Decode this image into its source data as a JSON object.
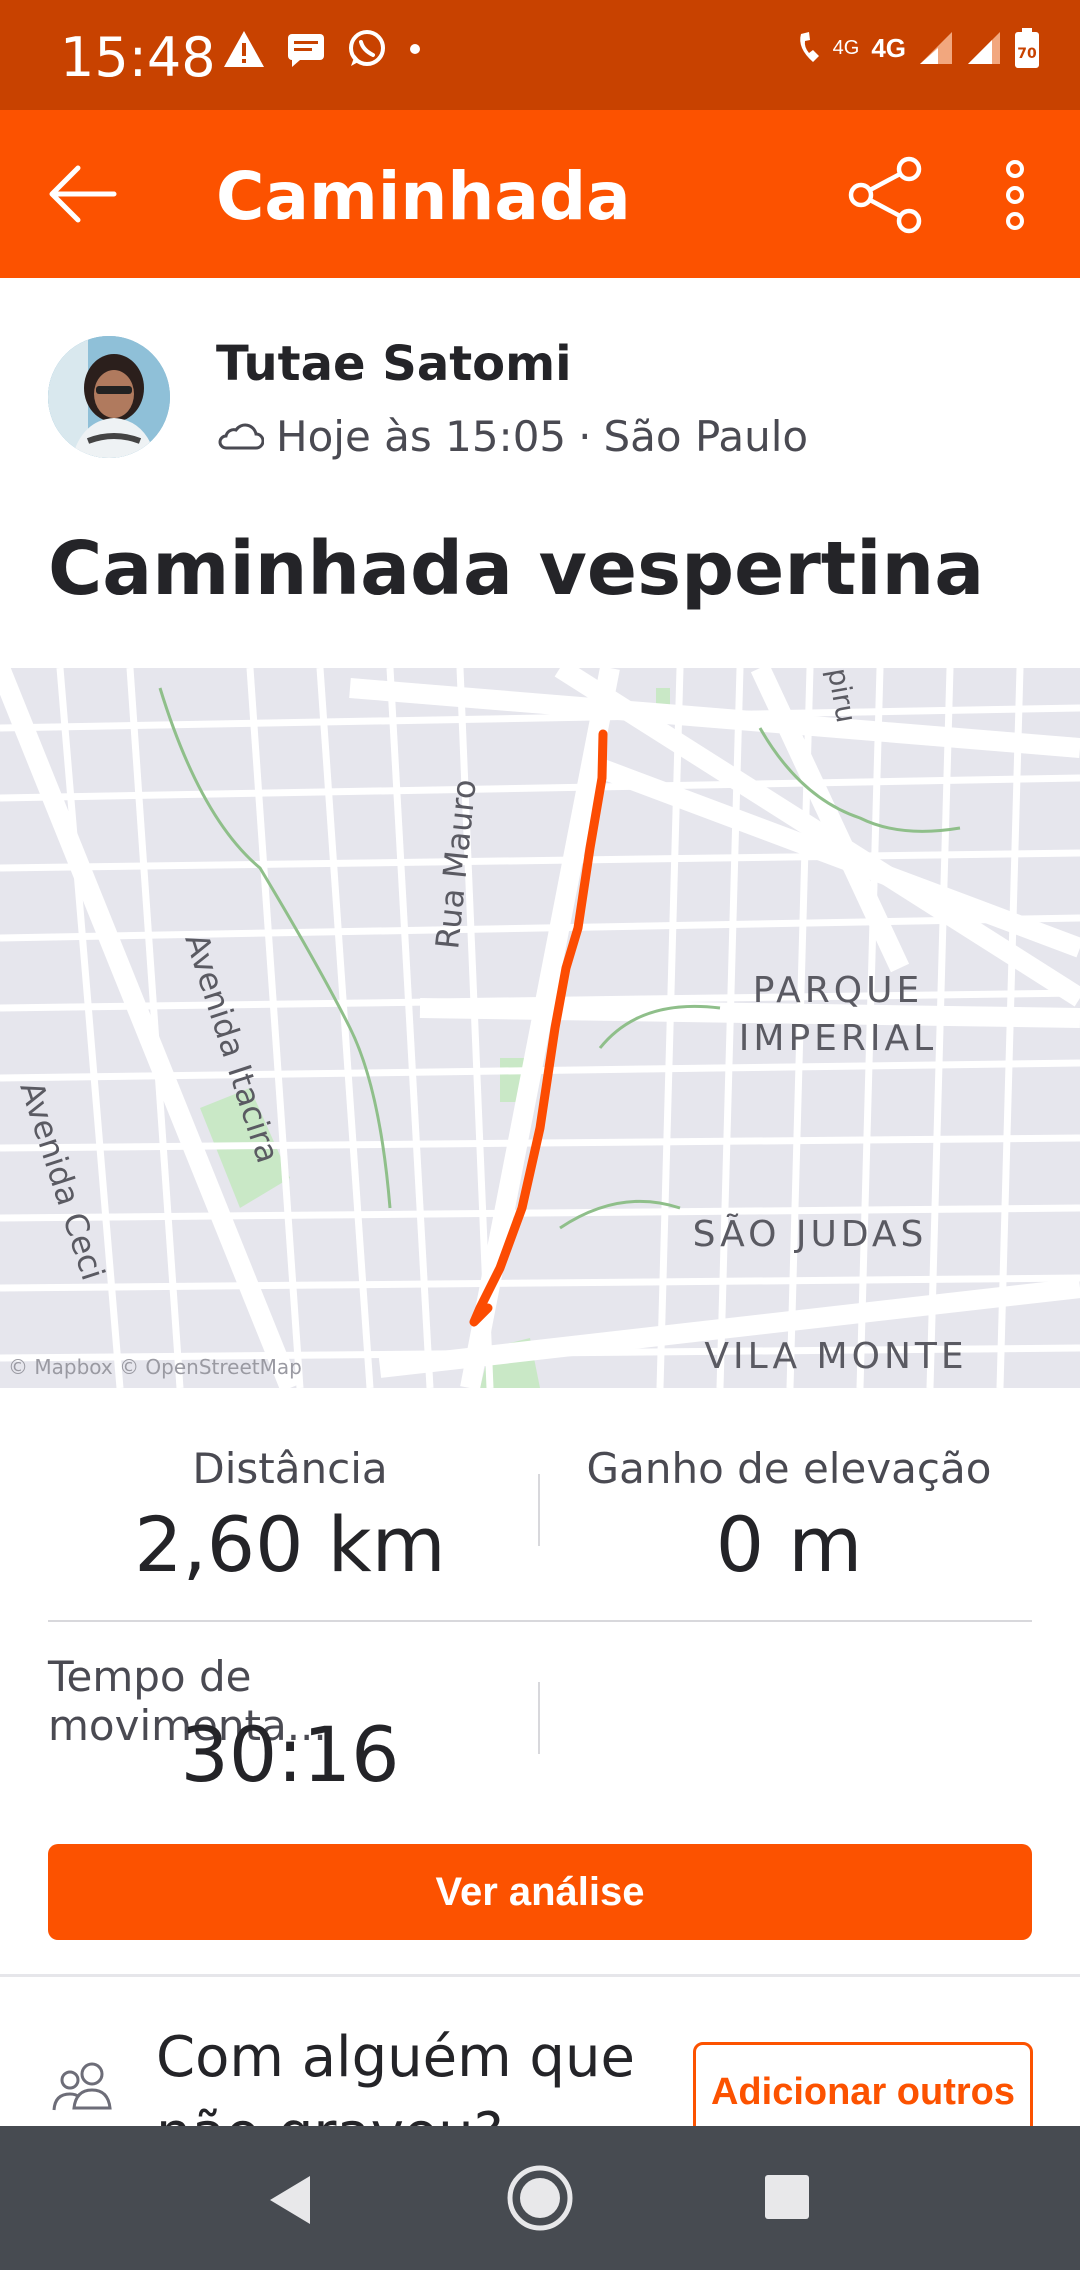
{
  "status_bar": {
    "time": "15:48",
    "network_label": "4G",
    "network_small": "4G",
    "battery": "70",
    "icons_left": [
      "warning-icon",
      "message-icon",
      "whatsapp-icon",
      "dot-icon"
    ],
    "icons_right": [
      "wifi-call-icon",
      "signal-icon",
      "signal-icon",
      "battery-icon"
    ]
  },
  "app_bar": {
    "title": "Caminhada",
    "back_icon": "arrow-left-icon",
    "share_icon": "share-icon",
    "more_icon": "more-vertical-icon",
    "background": "#fc5200"
  },
  "athlete": {
    "name": "Tutae Satomi",
    "weather_icon": "cloud-icon",
    "date_time": "Hoje às 15:05",
    "separator": "·",
    "location": "São Paulo"
  },
  "activity": {
    "title": "Caminhada vespertina"
  },
  "map": {
    "labels": {
      "street_1": "Rua Mauro",
      "street_2": "Avenida Itacira",
      "street_3": "Avenida Ceci",
      "street_4": "piru",
      "district_1a": "PARQUE",
      "district_1b": "IMPERIAL",
      "district_2": "SÃO JUDAS",
      "district_3": "VILA MONTE"
    },
    "attribution": "© Mapbox © OpenStreetMap",
    "route_color": "#fc4c02"
  },
  "stats": {
    "distance_label": "Distância",
    "distance_value": "2,60 km",
    "elevation_label": "Ganho de elevação",
    "elevation_value": "0 m",
    "moving_time_label": "Tempo de movimenta...",
    "moving_time_value": "30:16"
  },
  "cta": {
    "label": "Ver análise"
  },
  "with_others": {
    "text": "Com alguém que não gravou?",
    "button_label": "Adicionar outros",
    "icon": "people-icon"
  },
  "nav_bar": {
    "back_icon": "nav-back-icon",
    "home_icon": "nav-home-icon",
    "recent_icon": "nav-recent-icon"
  }
}
